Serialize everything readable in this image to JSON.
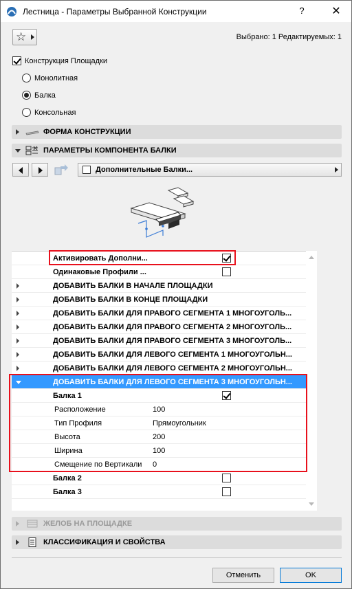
{
  "window": {
    "title": "Лестница - Параметры Выбранной Конструкции",
    "help_label": "?",
    "close_label": "✕"
  },
  "toolbar": {
    "favorites_icon": "star-icon",
    "selected_info": "Выбрано: 1 Редактируемых: 1"
  },
  "landing": {
    "checkbox_label": "Конструкция Площадки",
    "checked": true,
    "options": [
      {
        "label": "Монолитная",
        "selected": false
      },
      {
        "label": "Балка",
        "selected": true
      },
      {
        "label": "Консольная",
        "selected": false
      }
    ]
  },
  "sections": {
    "structure_form": "ФОРМА КОНСТРУКЦИИ",
    "beam_params": "ПАРАМЕТРЫ КОМПОНЕНТА БАЛКИ",
    "gutter": "ЖЕЛОБ НА ПЛОЩАДКЕ",
    "classification": "КЛАССИФИКАЦИЯ И СВОЙСТВА"
  },
  "component_nav": {
    "dropdown_value": "Дополнительные Балки..."
  },
  "list": {
    "activate_label": "Активировать Дополни...",
    "activate_checked": true,
    "same_profiles_label": "Одинаковые Профили ...",
    "same_profiles_checked": false,
    "groups": [
      "ДОБАВИТЬ БАЛКИ В НАЧАЛЕ ПЛОЩАДКИ",
      "ДОБАВИТЬ БАЛКИ В КОНЦЕ ПЛОЩАДКИ",
      "ДОБАВИТЬ БАЛКИ ДЛЯ ПРАВОГО СЕГМЕНТА 1 МНОГОУГОЛЬ...",
      "ДОБАВИТЬ БАЛКИ ДЛЯ ПРАВОГО СЕГМЕНТА 2 МНОГОУГОЛЬ...",
      "ДОБАВИТЬ БАЛКИ ДЛЯ ПРАВОГО СЕГМЕНТА 3 МНОГОУГОЛЬ...",
      "ДОБАВИТЬ БАЛКИ ДЛЯ ЛЕВОГО СЕГМЕНТА 1 МНОГОУГОЛЬН...",
      "ДОБАВИТЬ БАЛКИ ДЛЯ ЛЕВОГО СЕГМЕНТА 2 МНОГОУГОЛЬН..."
    ],
    "expanded_group": "ДОБАВИТЬ БАЛКИ ДЛЯ ЛЕВОГО СЕГМЕНТА 3 МНОГОУГОЛЬН...",
    "beam1_label": "Балка 1",
    "beam1_checked": true,
    "params": [
      {
        "name": "Расположение",
        "value": "100"
      },
      {
        "name": "Тип Профиля",
        "value": "Прямоугольник"
      },
      {
        "name": "Высота",
        "value": "200"
      },
      {
        "name": "Ширина",
        "value": "100"
      },
      {
        "name": "Смещение по Вертикали",
        "value": "0"
      }
    ],
    "beam2_label": "Балка 2",
    "beam2_checked": false,
    "beam3_label": "Балка 3",
    "beam3_checked": false
  },
  "footer": {
    "cancel_label": "Отменить",
    "ok_label": "OK"
  },
  "colors": {
    "selection": "#3399ff",
    "highlight_box": "#e8101c"
  }
}
